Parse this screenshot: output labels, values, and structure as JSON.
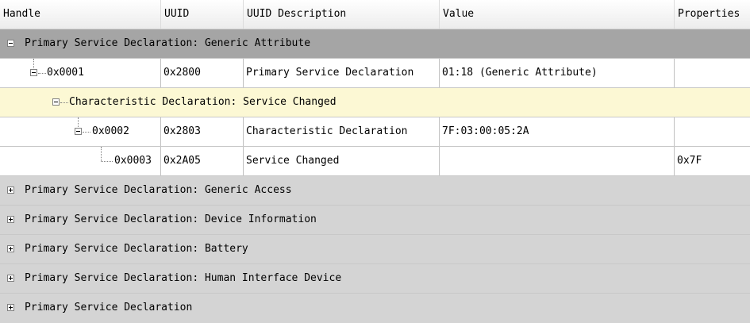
{
  "columns": {
    "handle": "Handle",
    "uuid": "UUID",
    "uuid_description": "UUID Description",
    "value": "Value",
    "properties": "Properties"
  },
  "service_generic_attribute": {
    "label": "Primary Service Declaration: Generic Attribute",
    "expand_icon": "minus-box-icon",
    "declaration": {
      "handle": "0x0001",
      "uuid": "0x2800",
      "description": "Primary Service Declaration",
      "value": "01:18 (Generic Attribute)",
      "properties": ""
    },
    "characteristic_group": {
      "label": "Characteristic Declaration: Service Changed",
      "expand_icon": "minus-box-icon",
      "declaration": {
        "handle": "0x0002",
        "uuid": "0x2803",
        "description": "Characteristic Declaration",
        "value": "7F:03:00:05:2A",
        "properties": ""
      },
      "value_attribute": {
        "handle": "0x0003",
        "uuid": "0x2A05",
        "description": "Service Changed",
        "value": "",
        "properties": "0x7F"
      }
    }
  },
  "collapsed_services": [
    {
      "label": "Primary Service Declaration: Generic Access",
      "expand_icon": "plus-box-icon"
    },
    {
      "label": "Primary Service Declaration: Device Information",
      "expand_icon": "plus-box-icon"
    },
    {
      "label": "Primary Service Declaration: Battery",
      "expand_icon": "plus-box-icon"
    },
    {
      "label": "Primary Service Declaration: Human Interface Device",
      "expand_icon": "plus-box-icon"
    },
    {
      "label": "Primary Service Declaration",
      "expand_icon": "plus-box-icon"
    }
  ]
}
